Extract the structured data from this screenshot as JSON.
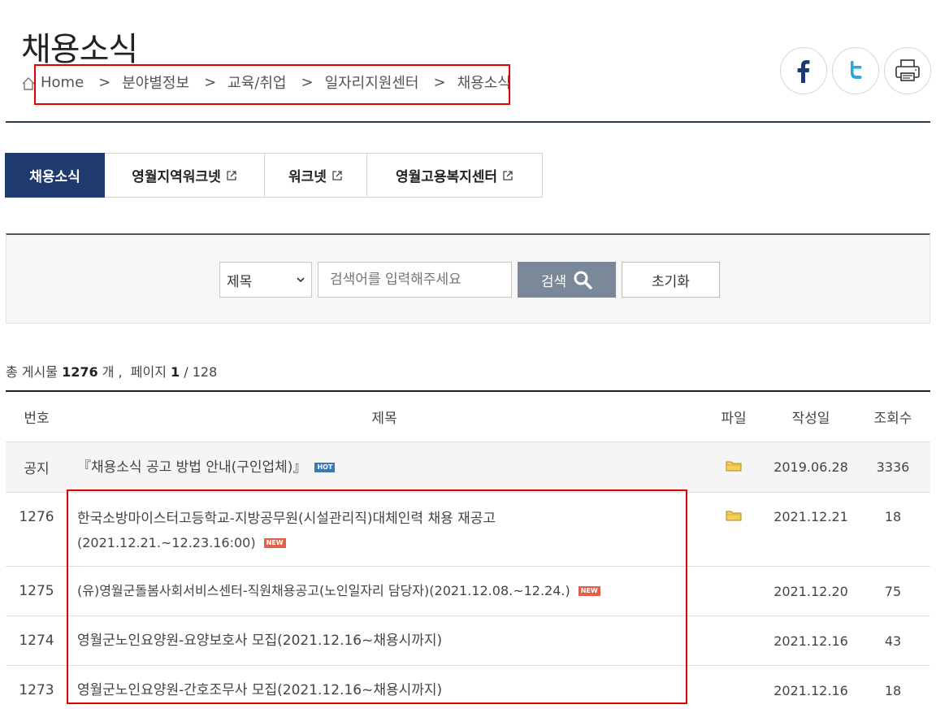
{
  "header": {
    "title": "채용소식",
    "breadcrumb": [
      "Home",
      "분야별정보",
      "교육/취업",
      "일자리지원센터",
      "채용소식"
    ],
    "breadcrumb_sep": ">"
  },
  "share": [
    "facebook",
    "twitter",
    "print"
  ],
  "tabs": [
    {
      "label": "채용소식",
      "active": true,
      "external": false
    },
    {
      "label": "영월지역워크넷",
      "active": false,
      "external": true
    },
    {
      "label": "워크넷",
      "active": false,
      "external": true
    },
    {
      "label": "영월고용복지센터",
      "active": false,
      "external": true
    }
  ],
  "search": {
    "select_value": "제목",
    "placeholder": "검색어를 입력해주세요",
    "search_label": "검색",
    "reset_label": "초기화"
  },
  "summary": {
    "prefix": "총 게시물",
    "total": "1276",
    "unit": "개 ,",
    "page_label": "페이지",
    "page": "1",
    "pages": "/ 128"
  },
  "table": {
    "columns": [
      "번호",
      "제목",
      "파일",
      "작성일",
      "조회수"
    ],
    "notice": {
      "no": "공지",
      "title": "『채용소식 공고 방법 안내(구인업체)』",
      "badge": "HOT",
      "file": true,
      "date": "2019.06.28",
      "views": "3336"
    },
    "rows": [
      {
        "no": "1276",
        "title_line1": "한국소방마이스터고등학교-지방공무원(시설관리직)대체인력 채용 재공고",
        "title_line2": "(2021.12.21.~12.23.16:00)",
        "badge": "NEW",
        "file": true,
        "date": "2021.12.21",
        "views": "18"
      },
      {
        "no": "1275",
        "title": "(유)영월군돌봄사회서비스센터-직원채용공고(노인일자리 담당자)(2021.12.08.~12.24.)",
        "badge": "NEW",
        "file": false,
        "date": "2021.12.20",
        "views": "75"
      },
      {
        "no": "1274",
        "title": "영월군노인요양원-요양보호사 모집(2021.12.16~채용시까지)",
        "file": false,
        "date": "2021.12.16",
        "views": "43"
      },
      {
        "no": "1273",
        "title": "영월군노인요양원-간호조무사 모집(2021.12.16~채용시까지)",
        "file": false,
        "date": "2021.12.16",
        "views": "18"
      }
    ]
  },
  "colors": {
    "accent": "#1e3a6e",
    "search_button": "#7b8899",
    "highlight": "#e00000",
    "hot": "#3a78b8",
    "new": "#e2604a"
  }
}
